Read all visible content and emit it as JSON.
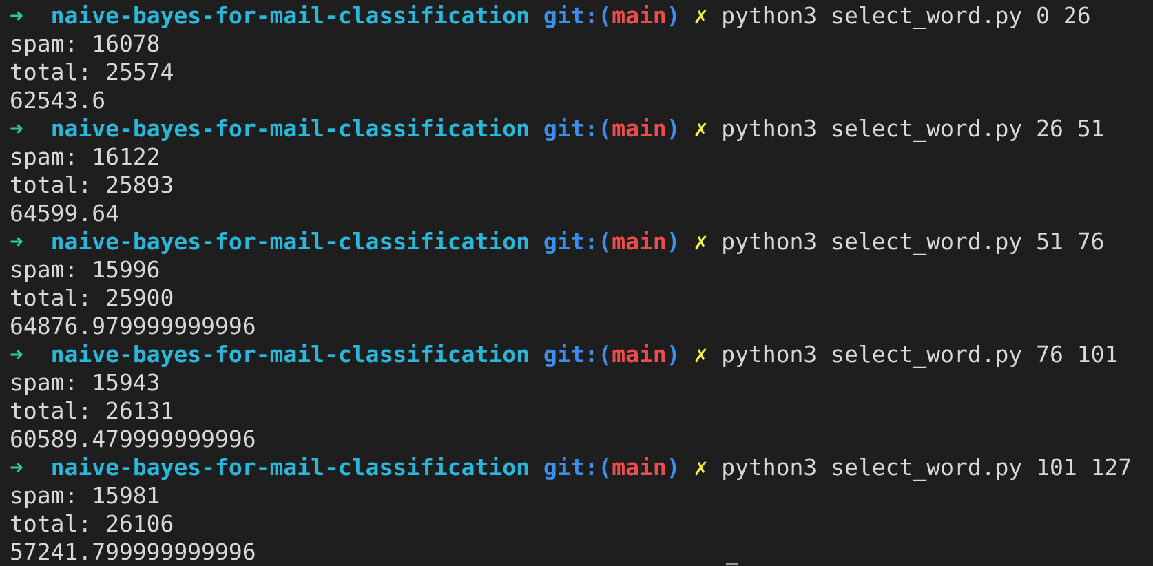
{
  "prompt": {
    "arrow": "➜",
    "directory": "naive-bayes-for-mail-classification",
    "git_prefix": "git:(",
    "branch": "main",
    "git_suffix": ")",
    "dirty_marker": "✗"
  },
  "runs": [
    {
      "command": "python3 select_word.py 0 26",
      "output": [
        "spam: 16078",
        "total: 25574",
        "62543.6"
      ]
    },
    {
      "command": "python3 select_word.py 26 51",
      "output": [
        "spam: 16122",
        "total: 25893",
        "64599.64"
      ]
    },
    {
      "command": "python3 select_word.py 51 76",
      "output": [
        "spam: 15996",
        "total: 25900",
        "64876.979999999996"
      ]
    },
    {
      "command": "python3 select_word.py 76 101",
      "output": [
        "spam: 15943",
        "total: 26131",
        "60589.479999999996"
      ]
    },
    {
      "command": "python3 select_word.py 101 127",
      "output": [
        "spam: 15981",
        "total: 26106",
        "57241.799999999996"
      ]
    }
  ]
}
